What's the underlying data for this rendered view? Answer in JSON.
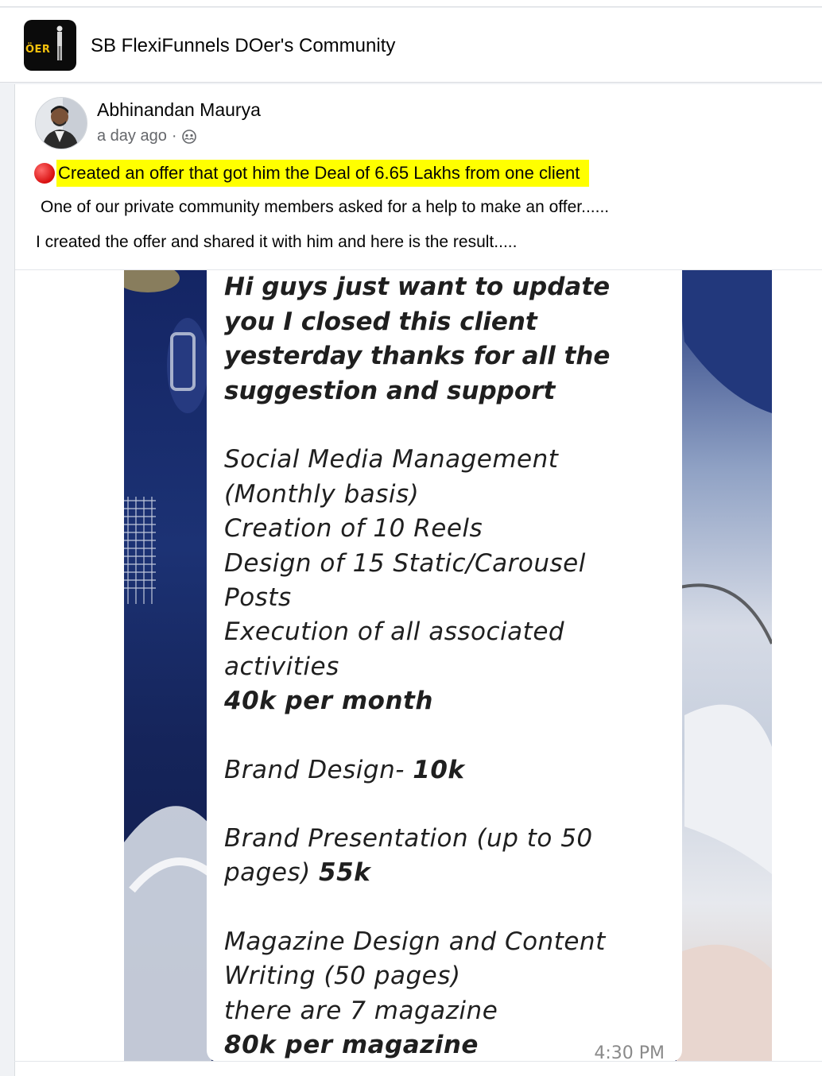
{
  "group": {
    "logo_text": "ÖER",
    "name": "SB FlexiFunnels DOer's Community"
  },
  "post": {
    "author": "Abhinandan Maurya",
    "time": "a day ago",
    "separator": "·",
    "audience_icon": "group-audience-icon",
    "headline_icon": "red-circle-emoji",
    "headline": "Created an offer that got him the Deal of 6.65 Lakhs from one client",
    "lines": [
      "One of our private community members asked for a help to make an offer......",
      "I created the offer and shared it with him and here is the result....."
    ]
  },
  "image": {
    "intro": [
      "Hi guys just want to update",
      "you I closed this client",
      "yesterday thanks for all the",
      "suggestion and support"
    ],
    "section1": [
      "Social Media Management",
      "(Monthly basis)",
      "Creation of 10 Reels",
      "Design of 15 Static/Carousel",
      "Posts",
      "Execution of all associated",
      "activities"
    ],
    "section1_price": "40k per month",
    "brand_design_label": "Brand Design- ",
    "brand_design_price": "10k",
    "brand_presentation_line1": "Brand Presentation (up to 50",
    "brand_presentation_label": "pages) ",
    "brand_presentation_price": "55k",
    "magazine": [
      "Magazine Design and Content",
      "Writing (50 pages)",
      "there are 7 magazine"
    ],
    "magazine_price": "80k per magazine",
    "timestamp": "4:30 PM"
  }
}
